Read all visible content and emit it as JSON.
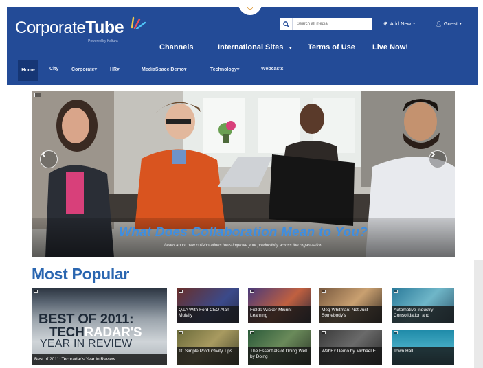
{
  "header": {
    "logo_main": "Corporate",
    "logo_bold": "Tube",
    "logo_sub": "Powered by Kaltura",
    "search_placeholder": "Search all media",
    "add_new": "Add New",
    "guest": "Guest"
  },
  "main_nav": [
    "Channels",
    "International Sites",
    "Terms of Use",
    "Live Now!"
  ],
  "sub_nav": [
    "Home",
    "City",
    "Corporate",
    "HR",
    "MediaSpace Demo",
    "Technology",
    "Webcasts"
  ],
  "hero": {
    "title": "What Does Collaboration Mean to You?",
    "subtitle": "Learn about new collaborations tools improve your productivity across the organization"
  },
  "most_popular": {
    "title": "Most Popular",
    "featured": {
      "line1": "BEST OF 2011:",
      "line2a": "TECH",
      "line2b": "RADAR'S",
      "line3": "YEAR IN REVIEW",
      "caption": "Best of 2011: Techradar's Year in Review"
    },
    "items": [
      {
        "caption": "Q&A With Ford CEO Alan Mulally"
      },
      {
        "caption": "Fields Wicker-Miurin: Learning"
      },
      {
        "caption": "Meg Whitman: Not Just Somebody's"
      },
      {
        "caption": "Automotive Industry Consolidation and"
      },
      {
        "caption": "10 Simple Productivity Tips"
      },
      {
        "caption": "The Essentials of Doing Well by Doing"
      },
      {
        "caption": "WebEx Demo by Michael E."
      },
      {
        "caption": "Town Hall"
      }
    ]
  },
  "colors": {
    "header_bg": "#234b97",
    "section_title": "#2a66b0",
    "hero_title": "#3f8ee0"
  }
}
